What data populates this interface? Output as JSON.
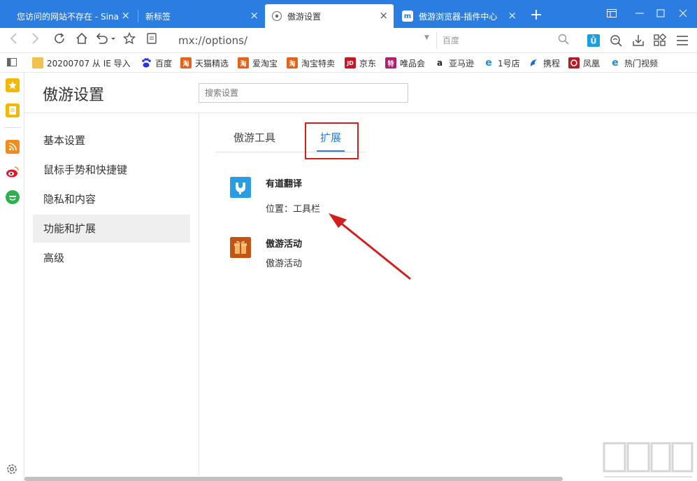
{
  "tabs": [
    {
      "label": "您访问的网站不存在 - Sina",
      "close": "×"
    },
    {
      "label": "新标签",
      "close": "×"
    },
    {
      "label": "傲游设置",
      "close": "×"
    },
    {
      "label": "傲游浏览器-插件中心",
      "close": "×"
    }
  ],
  "new_tab": "+",
  "address": {
    "url": "mx://options/",
    "search_engine": "百度"
  },
  "bookmarks": [
    {
      "label": "20200707 从 IE 导入",
      "icon": "folder-icon"
    },
    {
      "label": "百度",
      "icon": "baidu-icon"
    },
    {
      "label": "天猫精选",
      "icon": "tmall-icon",
      "glyph": "淘"
    },
    {
      "label": "爱淘宝",
      "icon": "aitaobao-icon",
      "glyph": "淘"
    },
    {
      "label": "淘宝特卖",
      "icon": "taobao-icon",
      "glyph": "淘"
    },
    {
      "label": "京东",
      "icon": "jd-icon",
      "glyph": "JD"
    },
    {
      "label": "唯品会",
      "icon": "vip-icon",
      "glyph": "特"
    },
    {
      "label": "亚马逊",
      "icon": "amazon-icon",
      "glyph": "a"
    },
    {
      "label": "1号店",
      "icon": "yhd-icon",
      "glyph": "e"
    },
    {
      "label": "携程",
      "icon": "ctrip-icon"
    },
    {
      "label": "凤凰",
      "icon": "ifeng-icon"
    },
    {
      "label": "热门视频",
      "icon": "video-icon",
      "glyph": "e"
    }
  ],
  "settings": {
    "title": "傲游设置",
    "search_placeholder": "搜索设置",
    "nav": [
      "基本设置",
      "鼠标手势和快捷键",
      "隐私和内容",
      "功能和扩展",
      "高级"
    ],
    "selected_nav": "功能和扩展",
    "panel_tabs": [
      "傲游工具",
      "扩展"
    ],
    "active_panel_tab": "扩展",
    "extensions": [
      {
        "name": "有道翻译",
        "detail": "位置：工具栏",
        "icon": "youdao-icon"
      },
      {
        "name": "傲游活动",
        "detail": "傲游活动",
        "icon": "gift-icon"
      }
    ]
  },
  "colors": {
    "brand_blue": "#2b7de1",
    "highlight_red": "#d0201e"
  }
}
